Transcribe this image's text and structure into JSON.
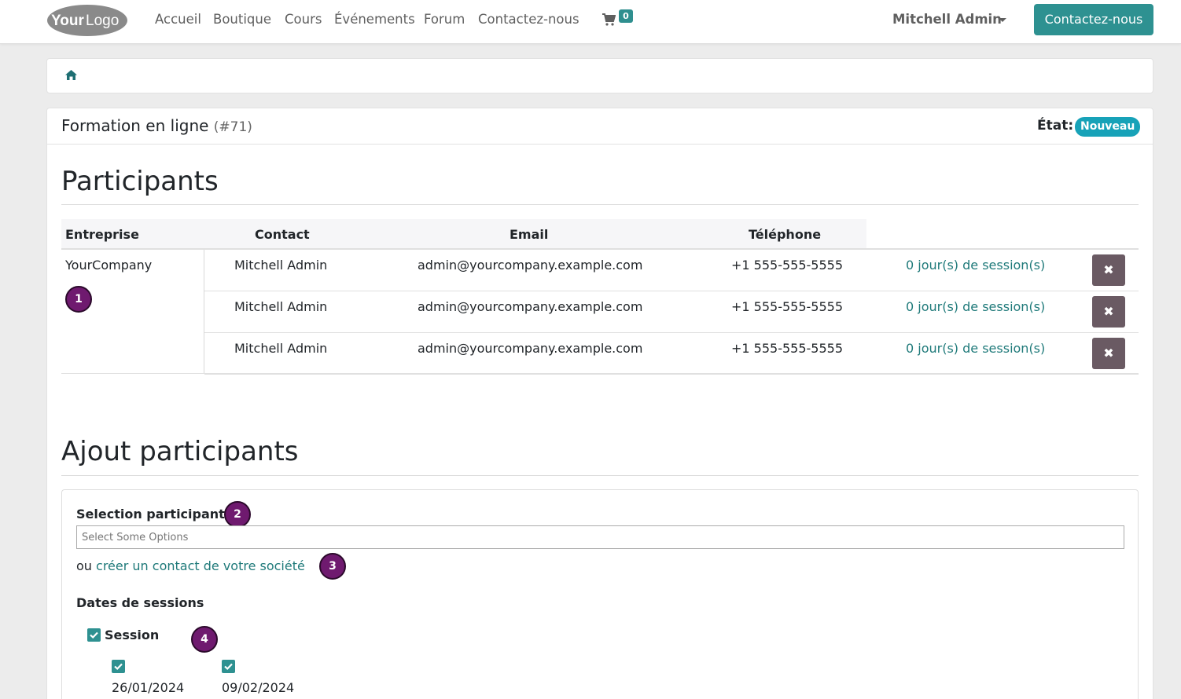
{
  "header": {
    "logo_text": "YourLogo",
    "nav": [
      "Accueil",
      "Boutique",
      "Cours",
      "Événements",
      "Forum",
      "Contactez-nous"
    ],
    "cart_count": "0",
    "user_name": "Mitchell Admin",
    "cta_label": "Contactez-nous"
  },
  "page": {
    "title": "Formation en ligne",
    "ref": "(#71)",
    "state_label": "État:",
    "state_value": "Nouveau"
  },
  "participants": {
    "section_title": "Participants",
    "columns": [
      "Entreprise",
      "Contact",
      "Email",
      "Téléphone"
    ],
    "company": "YourCompany",
    "rows": [
      {
        "contact": "Mitchell Admin",
        "email": "admin@yourcompany.example.com",
        "phone": "+1 555-555-5555",
        "sessions": "0 jour(s) de session(s)"
      },
      {
        "contact": "Mitchell Admin",
        "email": "admin@yourcompany.example.com",
        "phone": "+1 555-555-5555",
        "sessions": "0 jour(s) de session(s)"
      },
      {
        "contact": "Mitchell Admin",
        "email": "admin@yourcompany.example.com",
        "phone": "+1 555-555-5555",
        "sessions": "0 jour(s) de session(s)"
      }
    ]
  },
  "add": {
    "section_title": "Ajout participants",
    "select_label": "Selection participants",
    "select_placeholder": "Select Some Options",
    "or_text": "ou",
    "create_link": "créer un contact de votre société",
    "dates_label": "Dates de sessions",
    "session_label": "Session",
    "dates": [
      "26/01/2024",
      "09/02/2024"
    ]
  },
  "markers": [
    "1",
    "2",
    "3",
    "4"
  ],
  "colors": {
    "primary": "#2e9191",
    "badge": "#17a2b8",
    "marker": "#6f1a6f",
    "delete": "#6a5a63"
  }
}
